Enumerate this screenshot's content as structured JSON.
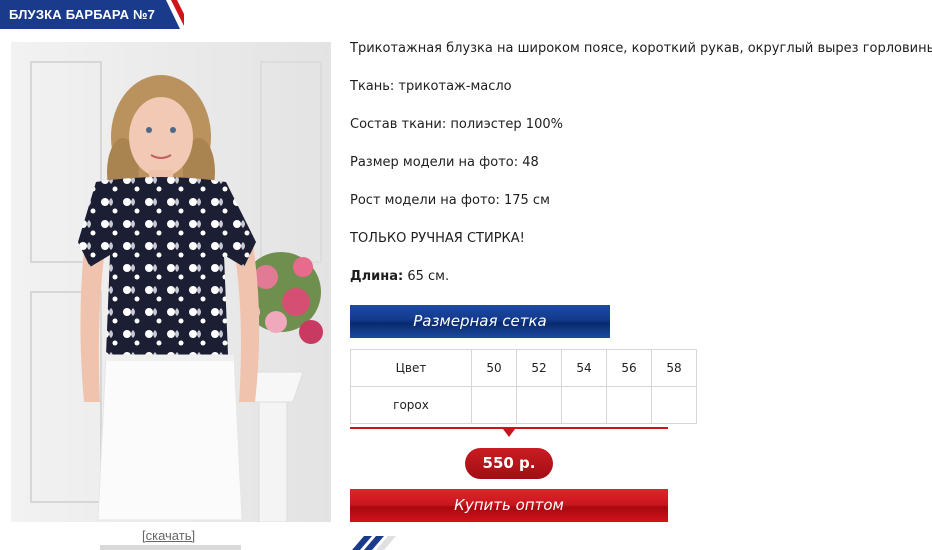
{
  "product": {
    "title": "БЛУЗКА БАРБАРА №7",
    "download_label": "[скачать]"
  },
  "description": {
    "line1": "Трикотажная блузка на широком поясе, короткий рукав, округлый вырез горловины.",
    "fabric": "Ткань: трикотаж-масло",
    "composition": "Состав ткани: полиэстер 100%",
    "model_size": "Размер модели на фото: 48",
    "model_height": "Рост модели на фото: 175 см",
    "wash": "ТОЛЬКО РУЧНАЯ СТИРКА!",
    "length_label": "Длина:",
    "length_value": "65 см."
  },
  "size_grid": {
    "button_label": "Размерная сетка",
    "header": [
      "Цвет",
      "50",
      "52",
      "54",
      "56",
      "58"
    ],
    "rows": [
      [
        "горох",
        "",
        "",
        "",
        "",
        ""
      ]
    ]
  },
  "price": "550 р.",
  "buy_label": "Купить оптом",
  "colors": {
    "brand_blue": "#123a8c",
    "accent_red": "#c8161d"
  }
}
